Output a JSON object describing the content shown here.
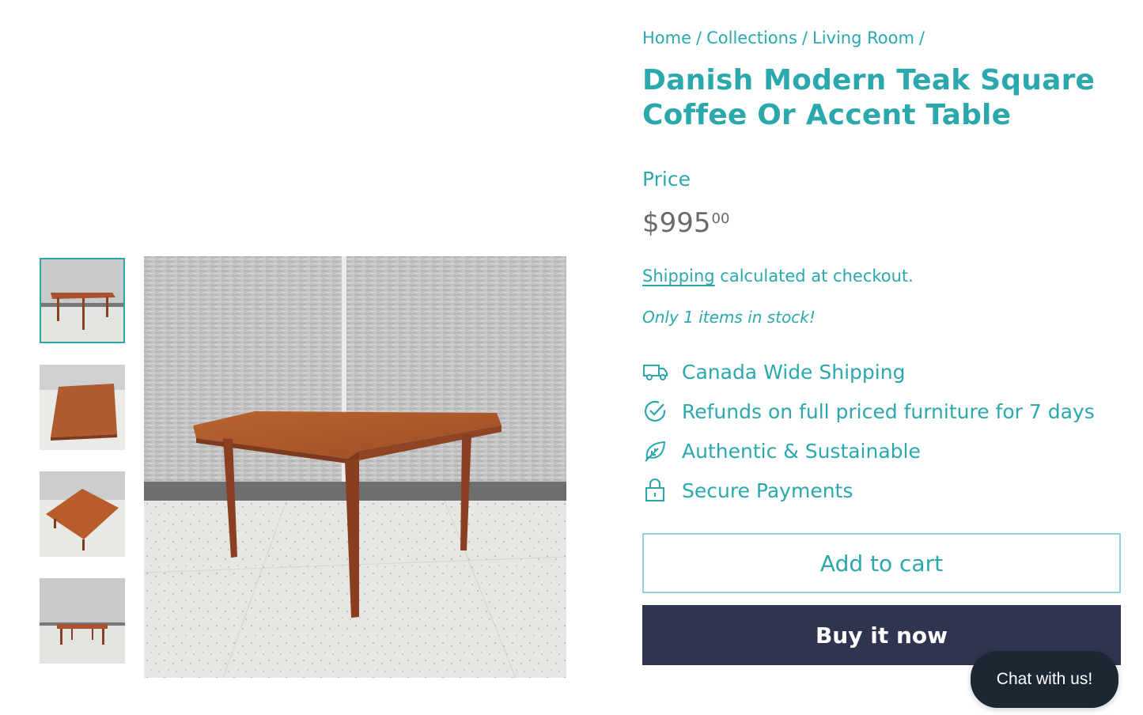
{
  "breadcrumb": [
    "Home",
    "Collections",
    "Living Room"
  ],
  "breadcrumb_separator": "/",
  "product": {
    "title": "Danish Modern Teak Square Coffee Or Accent Table",
    "price_label": "Price",
    "price_currency": "$",
    "price_whole": "995",
    "price_cents": "00",
    "shipping_link": "Shipping",
    "shipping_text": "calculated at checkout.",
    "stock_note": "Only 1 items in stock!"
  },
  "features": [
    {
      "icon": "truck-icon",
      "label": "Canada Wide Shipping"
    },
    {
      "icon": "check-circle-icon",
      "label": "Refunds on full priced furniture for 7 days"
    },
    {
      "icon": "leaf-icon",
      "label": "Authentic & Sustainable"
    },
    {
      "icon": "lock-icon",
      "label": "Secure Payments"
    }
  ],
  "actions": {
    "add_to_cart": "Add to cart",
    "buy_now": "Buy it now"
  },
  "chat": {
    "label": "Chat with us!"
  },
  "gallery": {
    "thumbnail_count": 4,
    "active_thumbnail": 1
  },
  "colors": {
    "accent": "#2aa8ae",
    "buy_button": "#313451",
    "chat_bubble": "#1b2733",
    "price": "#666a6e"
  }
}
